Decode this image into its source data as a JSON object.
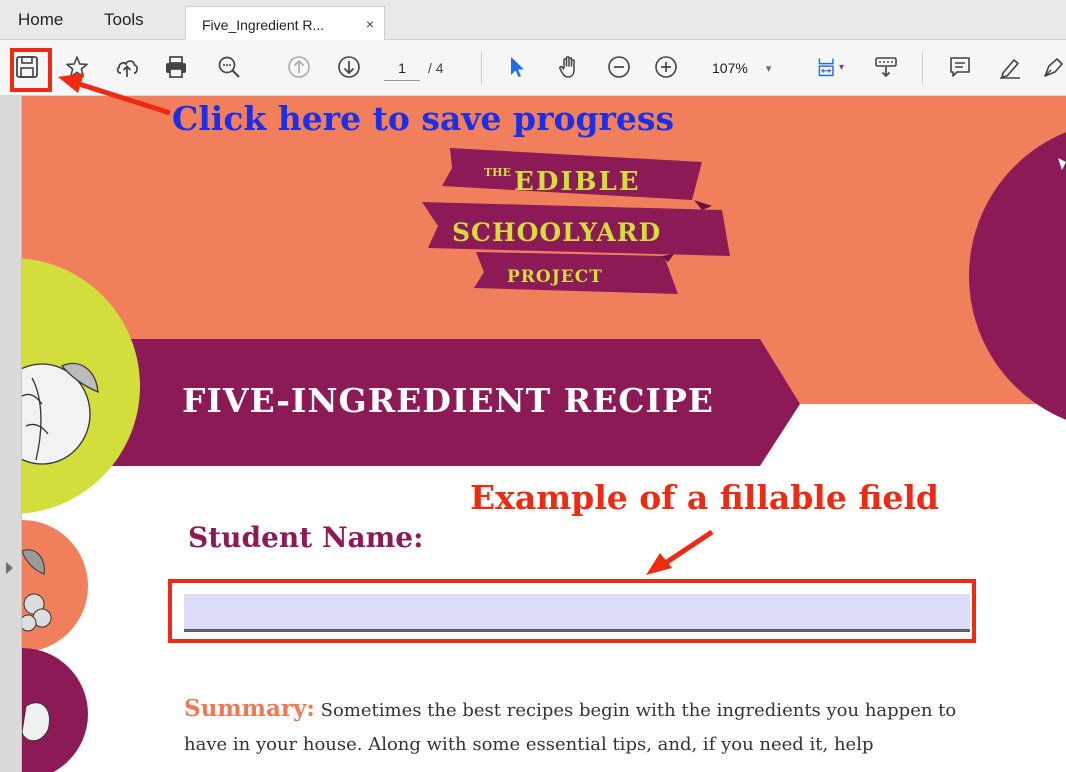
{
  "tabbar": {
    "home_label": "Home",
    "tools_label": "Tools",
    "doc_tab_title": "Five_Ingredient R...",
    "close_glyph": "×"
  },
  "toolbar": {
    "icons": [
      "save-icon",
      "bookmark-star-icon",
      "upload-cloud-icon",
      "print-icon",
      "zoom-search-icon",
      "page-up-icon",
      "page-down-icon",
      "select-pointer-icon",
      "hand-pan-icon",
      "zoom-out-icon",
      "zoom-in-icon",
      "fit-page-icon",
      "keyboard-scroll-icon",
      "comment-icon",
      "highlight-pen-icon",
      "sign-pen-icon"
    ],
    "page_current": "1",
    "page_total": "/ 4",
    "zoom": "107%",
    "zoom_caret": "▾",
    "fit_caret": "▾"
  },
  "document": {
    "logo": {
      "line1_small": "THE",
      "line1": "EDIBLE",
      "line2": "SCHOOLYARD",
      "line3": "PROJECT"
    },
    "title": "FIVE-INGREDIENT RECIPE",
    "student_name_label": "Student Name:",
    "student_name_value": "",
    "summary_label": "Summary:",
    "summary_text": "Sometimes the best recipes begin with the ingredients you happen to have in your house. Along with some essential tips, and, if you need it, help"
  },
  "annotations": {
    "save_hint": "Click here to save progress",
    "field_hint": "Example of a fillable field"
  },
  "colors": {
    "coral": "#f17f5c",
    "plum": "#8c1a57",
    "lime": "#d3de3c",
    "field_fill": "#dcdcfb",
    "annotation_red": "#ee2a12",
    "annotation_blue": "#1b2fe8"
  }
}
